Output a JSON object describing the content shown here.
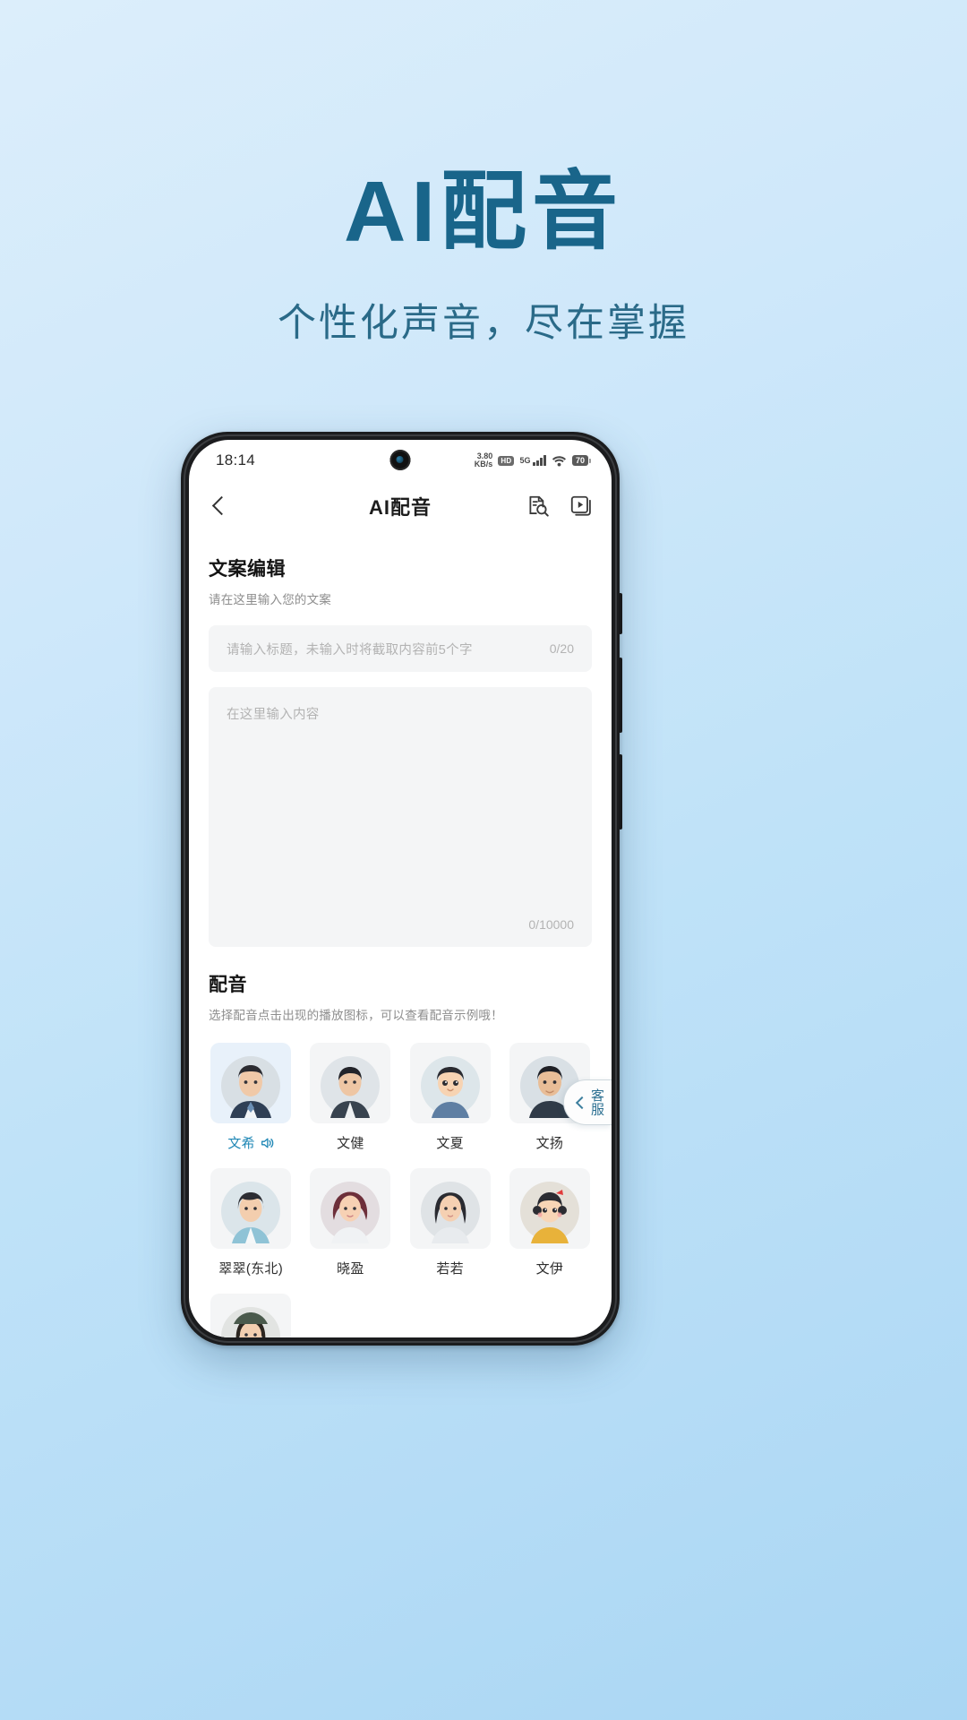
{
  "promo": {
    "title": "AI配音",
    "subtitle": "个性化声音，尽在掌握",
    "title_color": "#19658a",
    "subtitle_color": "#2a6a88"
  },
  "status_bar": {
    "time": "18:14",
    "net_speed_value": "3.80",
    "net_speed_unit": "KB/s",
    "hd_badge": "HD",
    "network": "5G",
    "battery": "70"
  },
  "app_header": {
    "title": "AI配音",
    "back_icon": "chevron-left-icon",
    "action_icons": [
      "document-search-icon",
      "video-library-icon"
    ]
  },
  "editor_section": {
    "heading": "文案编辑",
    "subheading": "请在这里输入您的文案",
    "title_field": {
      "placeholder": "请输入标题，未输入时将截取内容前5个字",
      "value": "",
      "counter": "0/20"
    },
    "content_field": {
      "placeholder": "在这里输入内容",
      "value": "",
      "counter": "0/10000"
    }
  },
  "voice_section": {
    "heading": "配音",
    "subheading": "选择配音点击出现的播放图标，可以查看配音示例哦！",
    "selected_accent": "#1f87b5",
    "voices": [
      {
        "name": "文希",
        "selected": true,
        "speaker_icon": "speaker-wave-icon",
        "type": "man-suit"
      },
      {
        "name": "文健",
        "selected": false,
        "speaker_icon": "",
        "type": "man-side"
      },
      {
        "name": "文夏",
        "selected": false,
        "speaker_icon": "",
        "type": "boy"
      },
      {
        "name": "文扬",
        "selected": false,
        "speaker_icon": "",
        "type": "man-dark"
      },
      {
        "name": "翠翠(东北)",
        "selected": false,
        "speaker_icon": "",
        "type": "woman-short"
      },
      {
        "name": "晓盈",
        "selected": false,
        "speaker_icon": "",
        "type": "woman-curly"
      },
      {
        "name": "若若",
        "selected": false,
        "speaker_icon": "",
        "type": "woman-long"
      },
      {
        "name": "文伊",
        "selected": false,
        "speaker_icon": "",
        "type": "girl"
      },
      {
        "name": "",
        "selected": false,
        "speaker_icon": "",
        "type": "woman-hat"
      }
    ]
  },
  "customer_service": {
    "label": "客服",
    "chevron_icon": "chevron-left-icon"
  }
}
